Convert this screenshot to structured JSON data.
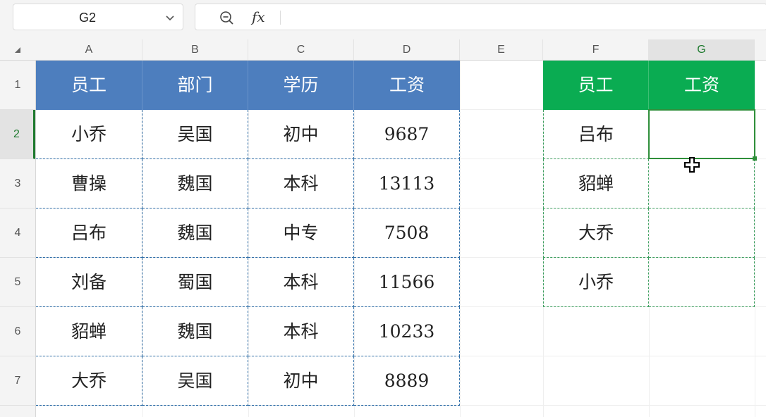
{
  "name_box": {
    "value": "G2"
  },
  "formula_bar": {
    "fx_label": "fx",
    "value": ""
  },
  "columns": [
    "A",
    "B",
    "C",
    "D",
    "E",
    "F",
    "G"
  ],
  "rows": [
    "1",
    "2",
    "3",
    "4",
    "5",
    "6",
    "7"
  ],
  "selected_cell": "G2",
  "table1": {
    "headers": [
      "员工",
      "部门",
      "学历",
      "工资"
    ],
    "rows": [
      [
        "小乔",
        "吴国",
        "初中",
        "9687"
      ],
      [
        "曹操",
        "魏国",
        "本科",
        "13113"
      ],
      [
        "吕布",
        "魏国",
        "中专",
        "7508"
      ],
      [
        "刘备",
        "蜀国",
        "本科",
        "11566"
      ],
      [
        "貂蝉",
        "魏国",
        "本科",
        "10233"
      ],
      [
        "大乔",
        "吴国",
        "初中",
        "8889"
      ]
    ],
    "header_color": "#4d7ebe"
  },
  "table2": {
    "headers": [
      "员工",
      "工资"
    ],
    "rows": [
      [
        "吕布",
        ""
      ],
      [
        "貂蝉",
        ""
      ],
      [
        "大乔",
        ""
      ],
      [
        "小乔",
        ""
      ]
    ],
    "header_color": "#0aac52"
  },
  "icons": [
    "chevron-down-icon",
    "zoom-out-icon",
    "select-all-icon",
    "cell-cursor-icon"
  ]
}
